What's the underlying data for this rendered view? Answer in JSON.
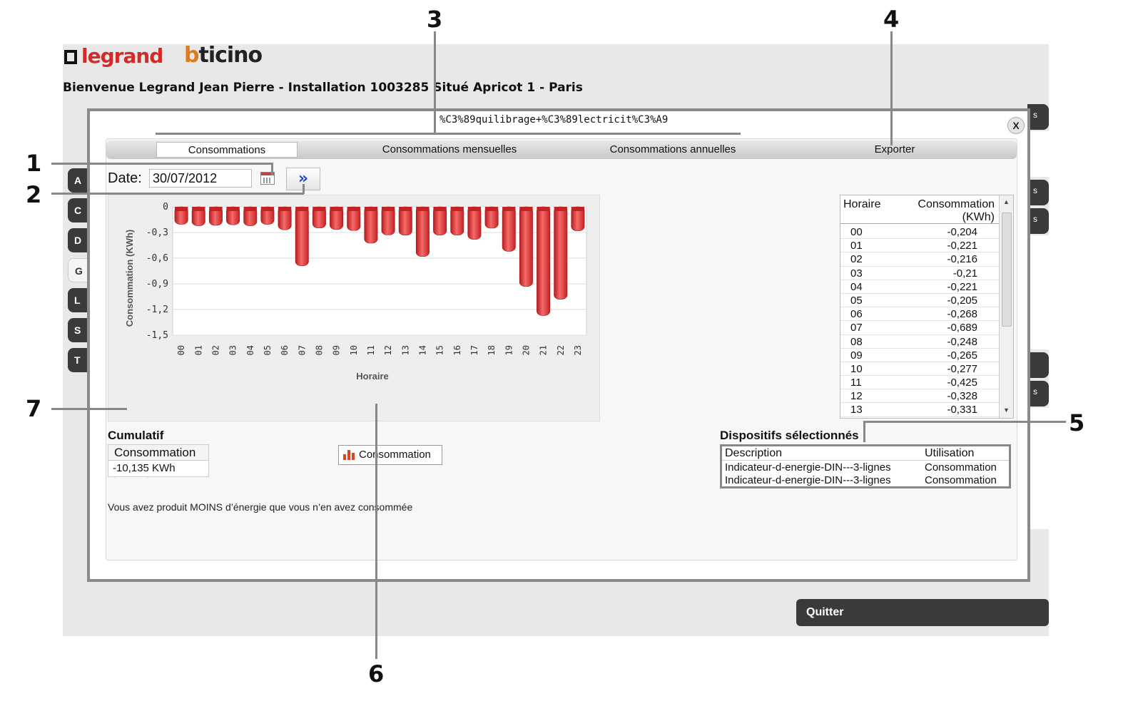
{
  "header": {
    "welcome": "Bienvenue Legrand Jean Pierre - Installation 1003285 Situé Apricot 1 - Paris",
    "logo_legrand": "legrand",
    "logo_bticino_b": "b",
    "logo_bticino_rest": "ticino"
  },
  "side_tabs": [
    "A",
    "C",
    "D",
    "G",
    "L",
    "S",
    "T"
  ],
  "right_tabs": [
    "s",
    "s",
    "s",
    "s"
  ],
  "quit_label": "Quitter",
  "modal": {
    "title": "%C3%89quilibrage+%C3%89lectricit%C3%A9",
    "close_label": "X",
    "tabs": [
      {
        "label": "Consommations"
      },
      {
        "label": "Consommations mensuelles"
      },
      {
        "label": "Consommations annuelles"
      },
      {
        "label": "Exporter"
      }
    ],
    "date_label": "Date:",
    "date_value": "30/07/2012",
    "go_label": "»",
    "legend_label": "Consommation",
    "table": {
      "col_horaire": "Horaire",
      "col_consommation": "Consommation (KWh)",
      "rows": [
        {
          "h": "00",
          "v": "-0,204"
        },
        {
          "h": "01",
          "v": "-0,221"
        },
        {
          "h": "02",
          "v": "-0,216"
        },
        {
          "h": "03",
          "v": "-0,21"
        },
        {
          "h": "04",
          "v": "-0,221"
        },
        {
          "h": "05",
          "v": "-0,205"
        },
        {
          "h": "06",
          "v": "-0,268"
        },
        {
          "h": "07",
          "v": "-0,689"
        },
        {
          "h": "08",
          "v": "-0,248"
        },
        {
          "h": "09",
          "v": "-0,265"
        },
        {
          "h": "10",
          "v": "-0,277"
        },
        {
          "h": "11",
          "v": "-0,425"
        },
        {
          "h": "12",
          "v": "-0,328"
        },
        {
          "h": "13",
          "v": "-0,331"
        }
      ]
    },
    "cumulatif": {
      "title": "Cumulatif",
      "header": "Consommation",
      "value": "-10,135 KWh"
    },
    "message": "Vous avez produit MOINS d’énergie que vous n’en avez consommée",
    "dispositifs": {
      "title": "Dispositifs sélectionnés",
      "col_description": "Description",
      "col_utilisation": "Utilisation",
      "rows": [
        {
          "description": "Indicateur-d-energie-DIN---3-lignes",
          "utilisation": "Consommation"
        },
        {
          "description": "Indicateur-d-energie-DIN---3-lignes",
          "utilisation": "Consommation"
        }
      ]
    }
  },
  "callouts": [
    "1",
    "2",
    "3",
    "4",
    "5",
    "6",
    "7"
  ],
  "colors": {
    "bar": "#e03434",
    "accent": "#1d48c8"
  },
  "chart_data": {
    "type": "bar",
    "xlabel": "Horaire",
    "ylabel": "Consommation (KWh)",
    "ylim": [
      -1.5,
      0
    ],
    "yticks": [
      "0",
      "-0,3",
      "-0,6",
      "-0,9",
      "-1,2",
      "-1,5"
    ],
    "categories": [
      "00",
      "01",
      "02",
      "03",
      "04",
      "05",
      "06",
      "07",
      "08",
      "09",
      "10",
      "11",
      "12",
      "13",
      "14",
      "15",
      "16",
      "17",
      "18",
      "19",
      "20",
      "21",
      "22",
      "23"
    ],
    "series": [
      {
        "name": "Consommation",
        "values": [
          -0.204,
          -0.221,
          -0.216,
          -0.21,
          -0.221,
          -0.205,
          -0.268,
          -0.689,
          -0.248,
          -0.265,
          -0.277,
          -0.425,
          -0.328,
          -0.331,
          -0.58,
          -0.33,
          -0.33,
          -0.38,
          -0.25,
          -0.52,
          -0.93,
          -1.27,
          -1.08,
          -0.28
        ]
      }
    ],
    "grid": true,
    "legend": "bottom-center"
  }
}
